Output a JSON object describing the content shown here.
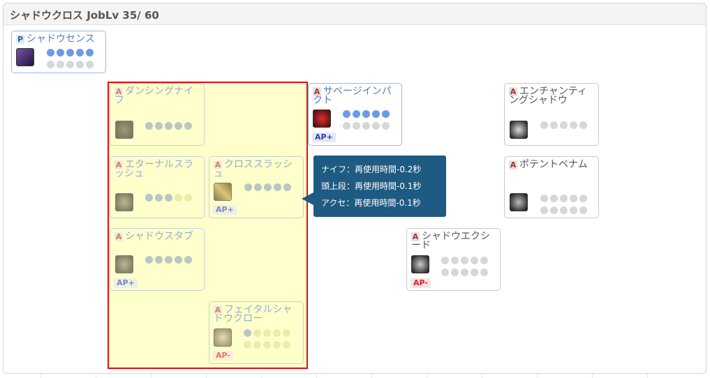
{
  "panel": {
    "title": "シャドウクロス JobLv 35/ 60"
  },
  "type_labels": {
    "active": "A",
    "passive": "P"
  },
  "skills": {
    "shadow_sense": {
      "type": "P",
      "name": "シャドウセンス",
      "level": 5,
      "max": 5
    },
    "dancing_knife": {
      "type": "A",
      "name": "ダンシングナイフ",
      "level": 5,
      "max": 5
    },
    "savage_impact": {
      "type": "A",
      "name": "サベージインパクト",
      "level": 5,
      "max": 5,
      "ap": "AP+"
    },
    "enchanting_shadow": {
      "type": "A",
      "name": "エンチャンティングシャドウ",
      "level": 0,
      "max": 5
    },
    "eternal_slash": {
      "type": "A",
      "name": "エターナルスラッシュ",
      "level": 3,
      "max": 5
    },
    "cross_slash": {
      "type": "A",
      "name": "クロススラッシュ",
      "level": 5,
      "max": 5,
      "ap": "AP+"
    },
    "potent_venom": {
      "type": "A",
      "name": "ポテントベナム",
      "level": 0,
      "max": 10
    },
    "shadow_stab": {
      "type": "A",
      "name": "シャドウスタブ",
      "level": 5,
      "max": 5,
      "ap": "AP+"
    },
    "shadow_exceed": {
      "type": "A",
      "name": "シャドウエクシード",
      "level": 0,
      "max": 10,
      "ap": "AP-"
    },
    "fatal_shadow_claw": {
      "type": "A",
      "name": "フェイタルシャドウクロー",
      "level": 1,
      "max": 10,
      "ap": "AP-"
    }
  },
  "tooltip": {
    "lines": [
      "ナイフ：再使用時間-0.2秒",
      "頭上段：再使用時間-0.1秒",
      "アクセ：再使用時間-0.1秒"
    ]
  },
  "colors": {
    "highlight_fill": "#ffffcc",
    "highlight_border": "#e01010",
    "tooltip_bg": "#1e5a82",
    "dot_blue": "#6b9be6"
  }
}
